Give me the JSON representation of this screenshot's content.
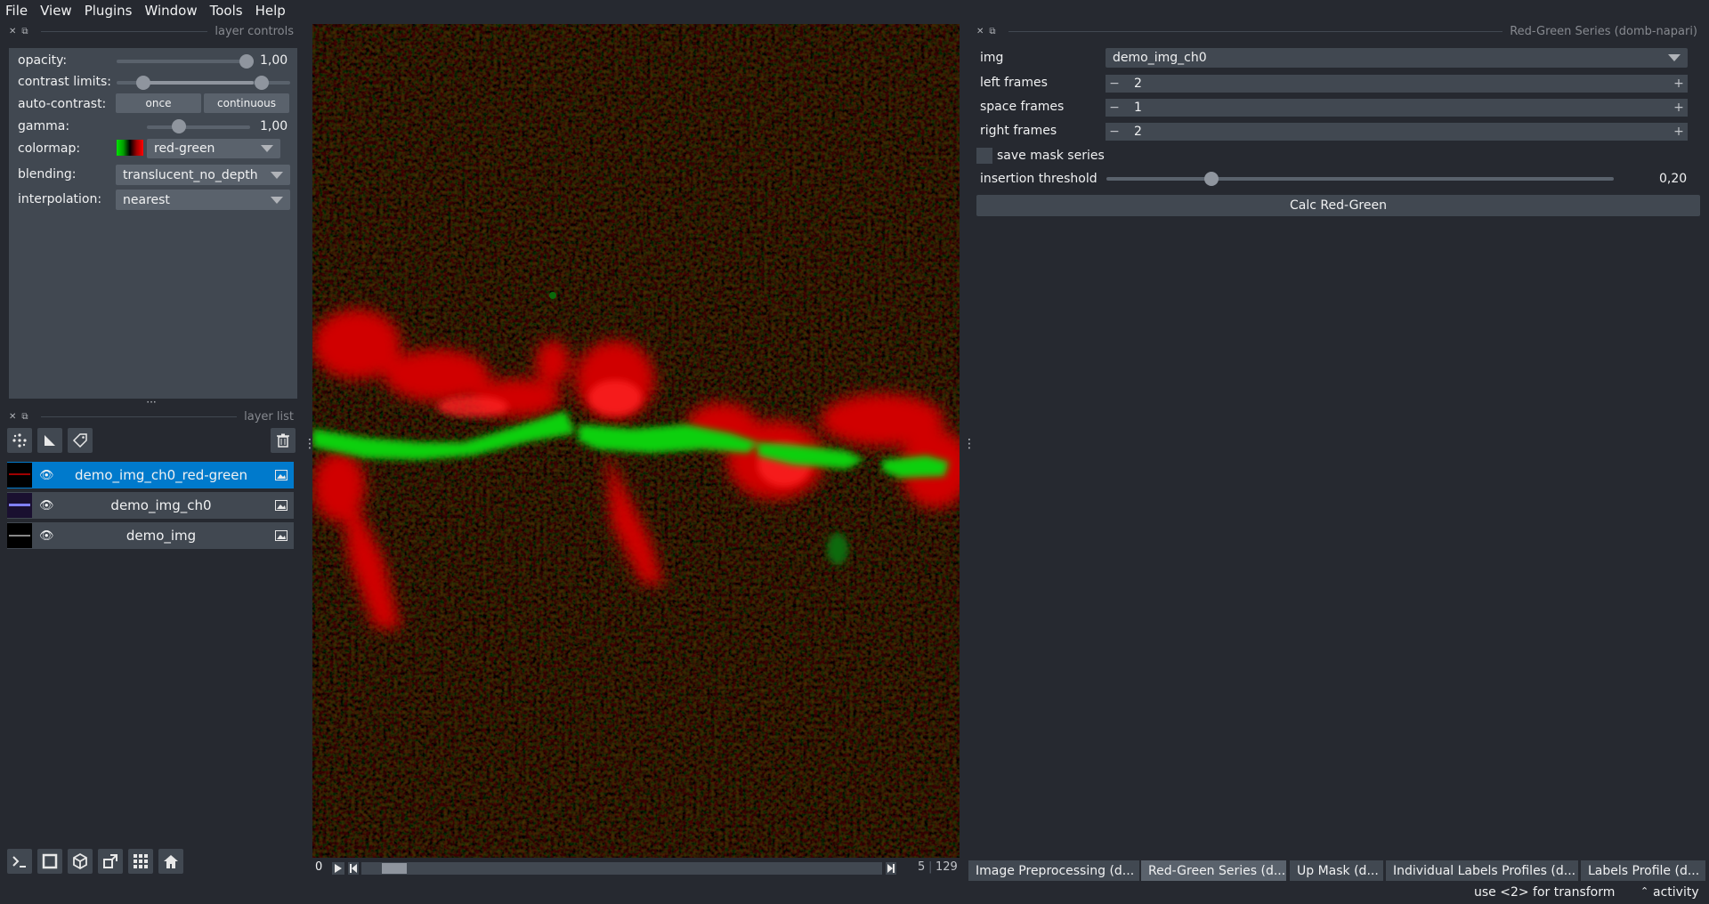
{
  "menu": [
    "File",
    "View",
    "Plugins",
    "Window",
    "Tools",
    "Help"
  ],
  "layer_controls": {
    "title": "layer controls",
    "opacity": {
      "label": "opacity:",
      "value": "1,00",
      "fraction": 1.0
    },
    "contrast_limits": {
      "label": "contrast limits:",
      "low_fraction": 0.15,
      "high_fraction": 0.85
    },
    "auto_contrast": {
      "label": "auto-contrast:",
      "once": "once",
      "continuous": "continuous"
    },
    "gamma": {
      "label": "gamma:",
      "value": "1,00",
      "fraction": 0.5
    },
    "colormap": {
      "label": "colormap:",
      "value": "red-green"
    },
    "blending": {
      "label": "blending:",
      "value": "translucent_no_depth"
    },
    "interpolation": {
      "label": "interpolation:",
      "value": "nearest"
    }
  },
  "layer_list": {
    "title": "layer list",
    "layers": [
      {
        "name": "demo_img_ch0_red-green",
        "selected": true
      },
      {
        "name": "demo_img_ch0",
        "selected": false
      },
      {
        "name": "demo_img",
        "selected": false
      }
    ]
  },
  "dims": {
    "start": "0",
    "current": "5",
    "total": "129"
  },
  "right_panel": {
    "title": "Red-Green Series (domb-napari)",
    "img_label": "img",
    "img_value": "demo_img_ch0",
    "left_frames_label": "left frames",
    "left_frames": "2",
    "space_frames_label": "space frames",
    "space_frames": "1",
    "right_frames_label": "right frames",
    "right_frames": "2",
    "save_mask_label": "save mask series",
    "insertion_threshold_label": "insertion threshold",
    "insertion_threshold": "0,20",
    "calc_button": "Calc Red-Green"
  },
  "tabs": [
    "Image Preprocessing (d...",
    "Red-Green Series (d...",
    "Up Mask (d...",
    "Individual Labels Profiles (d...",
    "Labels Profile (d..."
  ],
  "status": {
    "hint": "use <2> for transform",
    "activity": "activity"
  }
}
